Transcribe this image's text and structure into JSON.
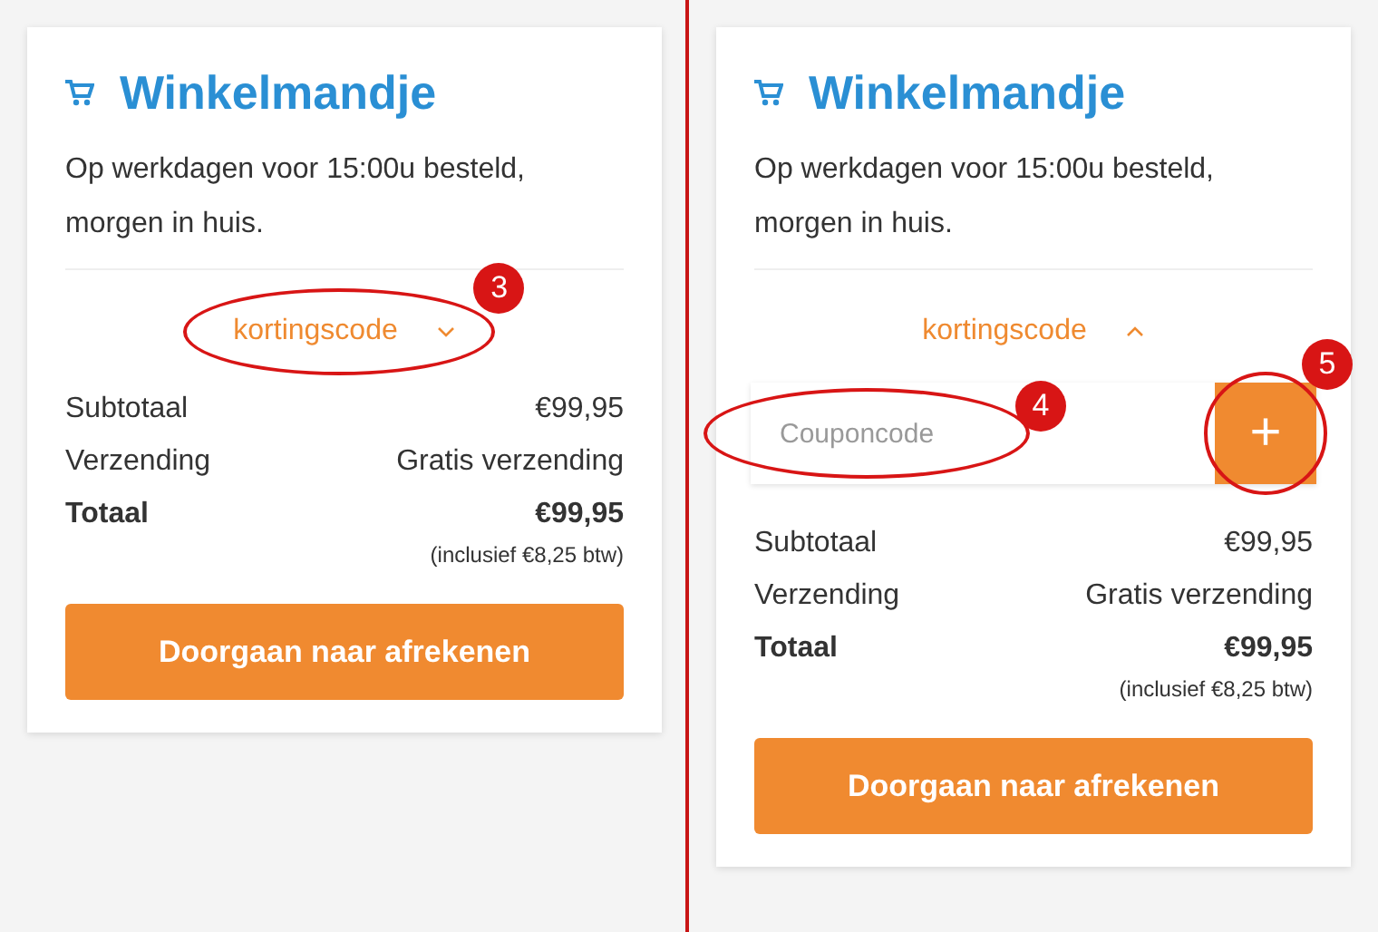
{
  "panels": [
    {
      "title": "Winkelmandje",
      "note": "Op werkdagen voor 15:00u besteld, morgen in huis.",
      "coupon_toggle": {
        "label": "kortingscode",
        "expanded": false
      },
      "rows": [
        {
          "label": "Subtotaal",
          "value": "€99,95",
          "kind": "plain"
        },
        {
          "label": "Verzending",
          "value": "Gratis verzending",
          "kind": "plain"
        },
        {
          "label": "Totaal",
          "value": "€99,95",
          "kind": "total"
        }
      ],
      "tax_note": "(inclusief €8,25 btw)",
      "checkout_button": "Doorgaan naar afrekenen",
      "annotations": [
        {
          "number": "3",
          "kind": "toggle"
        }
      ]
    },
    {
      "title": "Winkelmandje",
      "note": "Op werkdagen voor 15:00u besteld, morgen in huis.",
      "coupon_toggle": {
        "label": "kortingscode",
        "expanded": true
      },
      "coupon_field": {
        "placeholder": "Couponcode",
        "button": "+"
      },
      "rows": [
        {
          "label": "Subtotaal",
          "value": "€99,95",
          "kind": "plain"
        },
        {
          "label": "Verzending",
          "value": "Gratis verzending",
          "kind": "plain"
        },
        {
          "label": "Totaal",
          "value": "€99,95",
          "kind": "total"
        }
      ],
      "tax_note": "(inclusief €8,25 btw)",
      "checkout_button": "Doorgaan naar afrekenen",
      "annotations": [
        {
          "number": "4",
          "kind": "field"
        },
        {
          "number": "5",
          "kind": "add"
        }
      ]
    }
  ]
}
